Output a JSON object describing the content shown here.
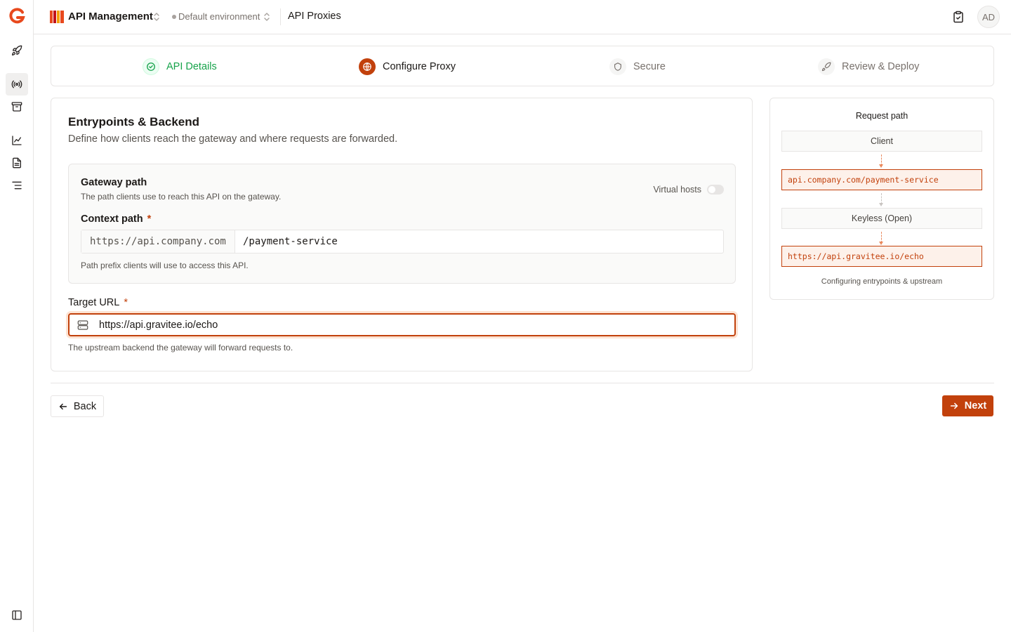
{
  "colors": {
    "accent": "#c2410c",
    "success": "#16a34a",
    "border": "#e7e5e4"
  },
  "topbar": {
    "app_name": "API Management",
    "environment": "Default environment",
    "breadcrumb": "API Proxies",
    "avatar_initials": "AD"
  },
  "rail": {
    "icons": [
      "gravitee-logo-icon",
      "rocket-icon",
      "broadcast-icon",
      "archive-icon",
      "chart-icon",
      "document-icon",
      "list-icon",
      "sidebar-toggle-icon"
    ]
  },
  "stepper": {
    "steps": [
      {
        "label": "API Details",
        "state": "done",
        "icon": "check-circle-icon"
      },
      {
        "label": "Configure Proxy",
        "state": "active",
        "icon": "globe-icon"
      },
      {
        "label": "Secure",
        "state": "todo",
        "icon": "shield-icon"
      },
      {
        "label": "Review & Deploy",
        "state": "todo",
        "icon": "rocket-icon"
      }
    ]
  },
  "main": {
    "title": "Entrypoints & Backend",
    "description": "Define how clients reach the gateway and where requests are forwarded.",
    "gateway": {
      "title": "Gateway path",
      "description": "The path clients use to reach this API on the gateway.",
      "virtual_hosts_label": "Virtual hosts",
      "virtual_hosts_enabled": false,
      "context_label": "Context path",
      "required_mark": "*",
      "context_prefix": "https://api.company.com",
      "context_value": "/payment-service",
      "context_hint": "Path prefix clients will use to access this API."
    },
    "target": {
      "label": "Target URL",
      "required_mark": "*",
      "value": "https://api.gravitee.io/echo",
      "hint": "The upstream backend the gateway will forward requests to."
    }
  },
  "side": {
    "title": "Request path",
    "nodes": [
      "Client",
      "api.company.com/payment-service",
      "Keyless (Open)",
      "https://api.gravitee.io/echo"
    ],
    "caption": "Configuring entrypoints & upstream"
  },
  "footer": {
    "back_label": "Back",
    "next_label": "Next"
  }
}
